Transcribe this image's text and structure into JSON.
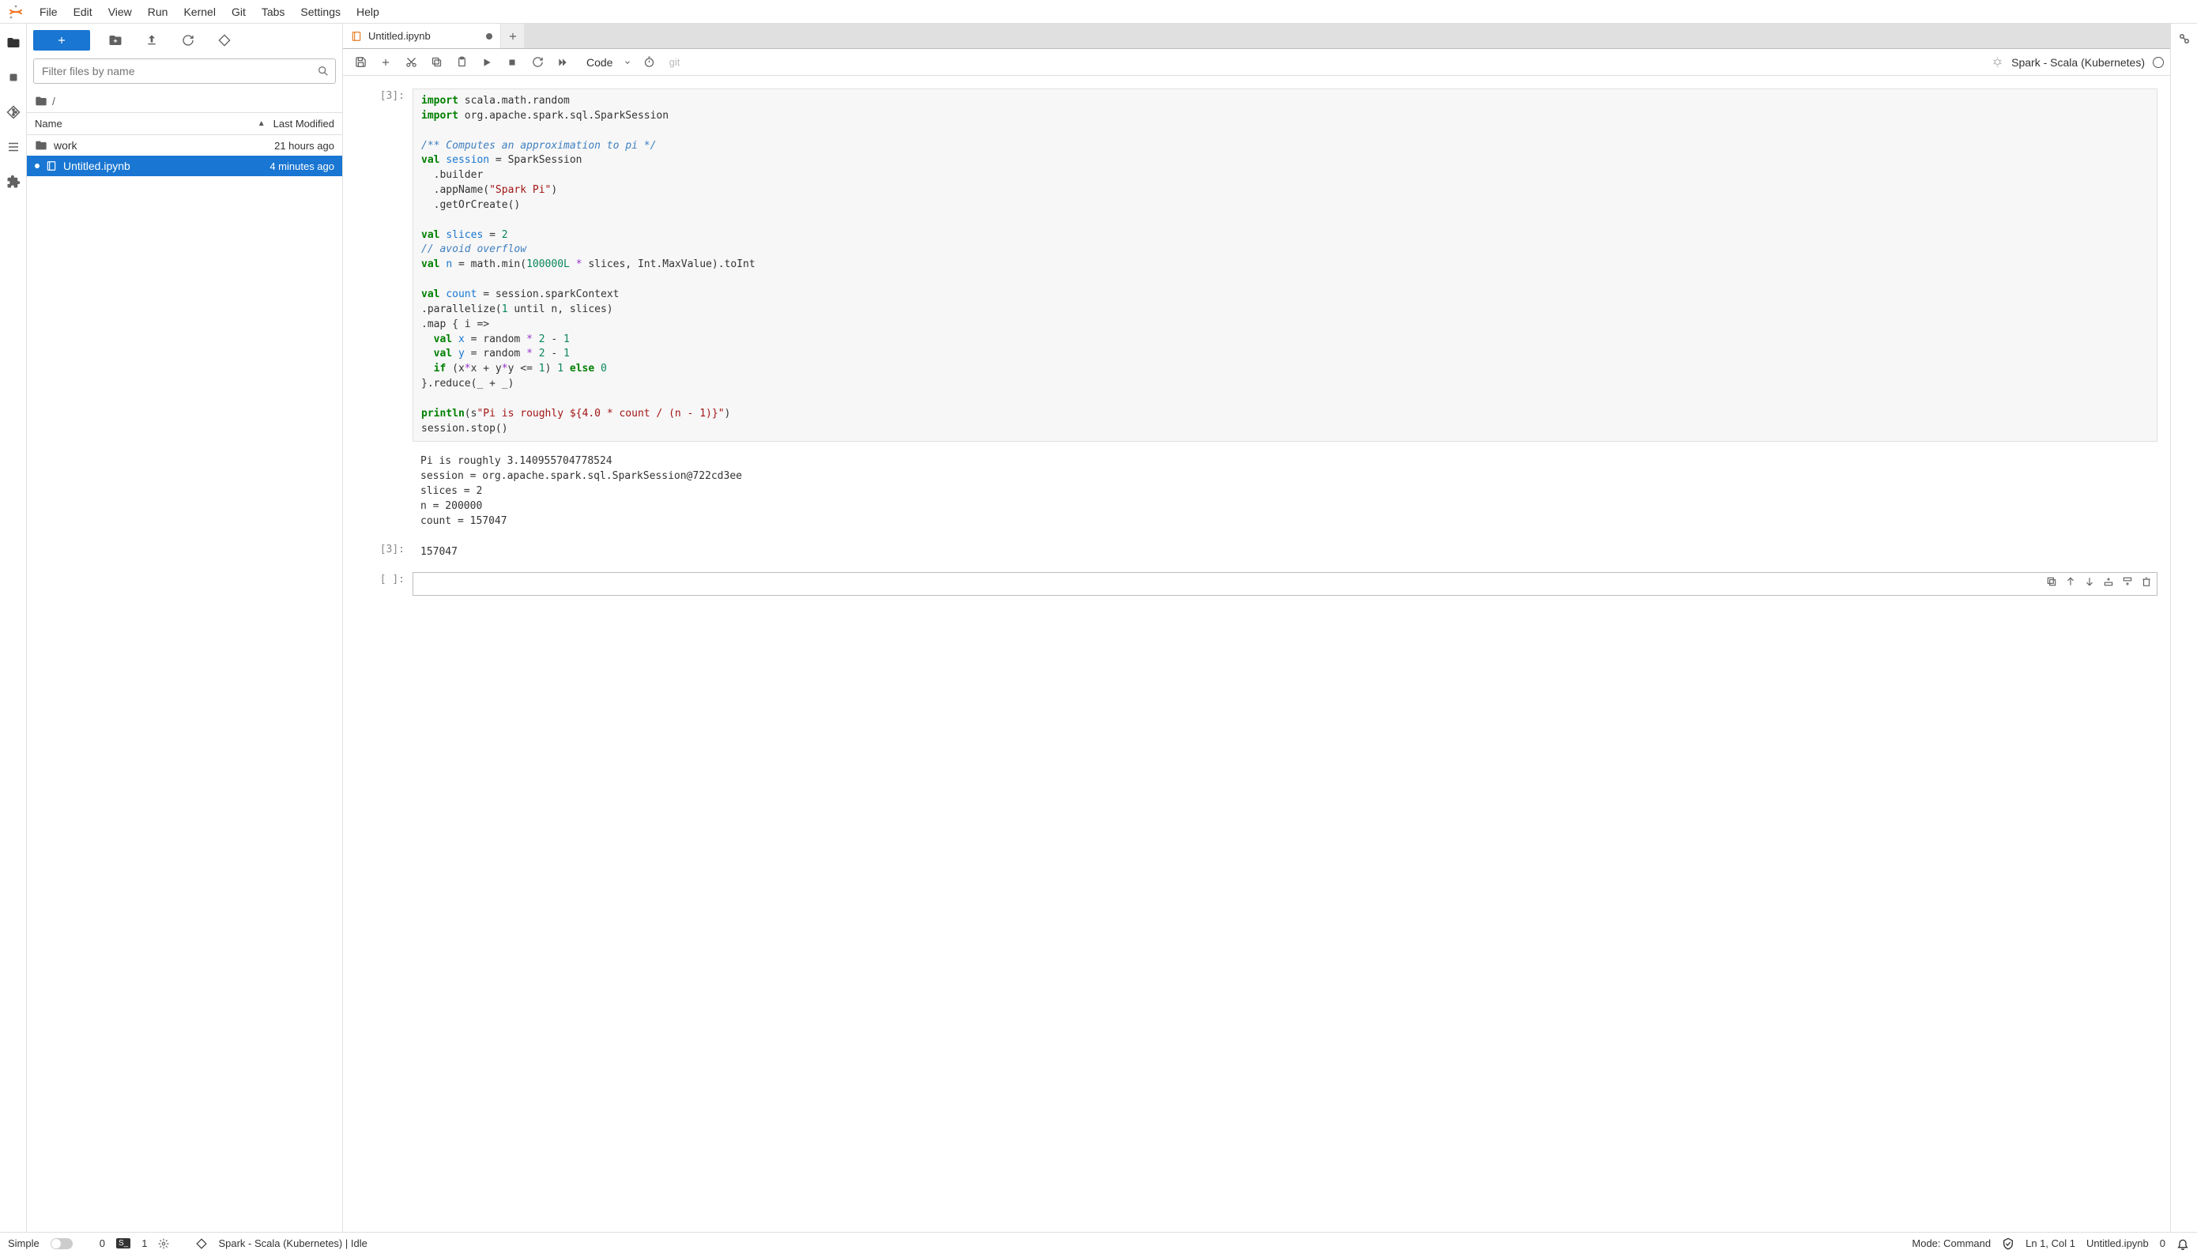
{
  "menubar": {
    "items": [
      "File",
      "Edit",
      "View",
      "Run",
      "Kernel",
      "Git",
      "Tabs",
      "Settings",
      "Help"
    ]
  },
  "sidebar": {
    "filter_placeholder": "Filter files by name",
    "breadcrumb": "/",
    "columns": {
      "name": "Name",
      "modified": "Last Modified"
    },
    "files": [
      {
        "icon": "folder",
        "name": "work",
        "modified": "21 hours ago",
        "selected": false
      },
      {
        "icon": "notebook",
        "name": "Untitled.ipynb",
        "modified": "4 minutes ago",
        "selected": true,
        "dirty": true
      }
    ]
  },
  "tabs": {
    "items": [
      {
        "name": "Untitled.ipynb",
        "dirty": true
      }
    ]
  },
  "nb_toolbar": {
    "cell_type": "Code",
    "git_label": "git",
    "kernel_label": "Spark - Scala (Kubernetes)"
  },
  "cells": {
    "exec1_prompt": "[3]:",
    "code_tokens": [
      {
        "c": "k-import",
        "t": "import"
      },
      {
        "t": " scala.math.random\n"
      },
      {
        "c": "k-import",
        "t": "import"
      },
      {
        "t": " org.apache.spark.sql.SparkSession\n\n"
      },
      {
        "c": "k-comment",
        "t": "/** Computes an approximation to pi */"
      },
      {
        "t": "\n"
      },
      {
        "c": "k-keyword",
        "t": "val"
      },
      {
        "t": " "
      },
      {
        "c": "k-name",
        "t": "session"
      },
      {
        "t": " = SparkSession\n"
      },
      {
        "t": "  .builder\n"
      },
      {
        "t": "  .appName("
      },
      {
        "c": "k-str",
        "t": "\"Spark Pi\""
      },
      {
        "t": ")\n"
      },
      {
        "t": "  .getOrCreate()\n\n"
      },
      {
        "c": "k-keyword",
        "t": "val"
      },
      {
        "t": " "
      },
      {
        "c": "k-name",
        "t": "slices"
      },
      {
        "t": " = "
      },
      {
        "c": "k-num",
        "t": "2"
      },
      {
        "t": "\n"
      },
      {
        "c": "k-comment",
        "t": "// avoid overflow"
      },
      {
        "t": "\n"
      },
      {
        "c": "k-keyword",
        "t": "val"
      },
      {
        "t": " "
      },
      {
        "c": "k-name",
        "t": "n"
      },
      {
        "t": " = math.min("
      },
      {
        "c": "k-num",
        "t": "100000L"
      },
      {
        "t": " "
      },
      {
        "c": "k-op",
        "t": "*"
      },
      {
        "t": " slices, Int.MaxValue).toInt\n\n"
      },
      {
        "c": "k-keyword",
        "t": "val"
      },
      {
        "t": " "
      },
      {
        "c": "k-name",
        "t": "count"
      },
      {
        "t": " = session.sparkContext\n"
      },
      {
        "t": ".parallelize("
      },
      {
        "c": "k-num",
        "t": "1"
      },
      {
        "t": " until n, slices)\n"
      },
      {
        "t": ".map { i =>\n"
      },
      {
        "t": "  "
      },
      {
        "c": "k-keyword",
        "t": "val"
      },
      {
        "t": " "
      },
      {
        "c": "k-name",
        "t": "x"
      },
      {
        "t": " = random "
      },
      {
        "c": "k-op",
        "t": "*"
      },
      {
        "t": " "
      },
      {
        "c": "k-num",
        "t": "2"
      },
      {
        "t": " - "
      },
      {
        "c": "k-num",
        "t": "1"
      },
      {
        "t": "\n"
      },
      {
        "t": "  "
      },
      {
        "c": "k-keyword",
        "t": "val"
      },
      {
        "t": " "
      },
      {
        "c": "k-name",
        "t": "y"
      },
      {
        "t": " = random "
      },
      {
        "c": "k-op",
        "t": "*"
      },
      {
        "t": " "
      },
      {
        "c": "k-num",
        "t": "2"
      },
      {
        "t": " - "
      },
      {
        "c": "k-num",
        "t": "1"
      },
      {
        "t": "\n"
      },
      {
        "t": "  "
      },
      {
        "c": "k-keyword",
        "t": "if"
      },
      {
        "t": " (x"
      },
      {
        "c": "k-op",
        "t": "*"
      },
      {
        "t": "x + y"
      },
      {
        "c": "k-op",
        "t": "*"
      },
      {
        "t": "y <= "
      },
      {
        "c": "k-num",
        "t": "1"
      },
      {
        "t": ") "
      },
      {
        "c": "k-num",
        "t": "1"
      },
      {
        "t": " "
      },
      {
        "c": "k-keyword",
        "t": "else"
      },
      {
        "t": " "
      },
      {
        "c": "k-num",
        "t": "0"
      },
      {
        "t": "\n"
      },
      {
        "t": "}.reduce(_ + _)\n\n"
      },
      {
        "c": "k-keyword",
        "t": "println"
      },
      {
        "t": "(s"
      },
      {
        "c": "k-str",
        "t": "\"Pi is roughly ${4.0 * count / (n - 1)}\""
      },
      {
        "t": ")\n"
      },
      {
        "t": "session.stop()"
      }
    ],
    "stdout": "Pi is roughly 3.140955704778524\nsession = org.apache.spark.sql.SparkSession@722cd3ee\nslices = 2\nn = 200000\ncount = 157047",
    "result_prompt": "[3]:",
    "result_value": "157047",
    "empty_prompt": "[ ]:"
  },
  "statusbar": {
    "simple": "Simple",
    "left_count": "0",
    "term_count": "1",
    "kernel_status": "Spark - Scala (Kubernetes) | Idle",
    "mode": "Mode: Command",
    "cursor": "Ln 1, Col 1",
    "filename": "Untitled.ipynb",
    "right_count": "0"
  }
}
